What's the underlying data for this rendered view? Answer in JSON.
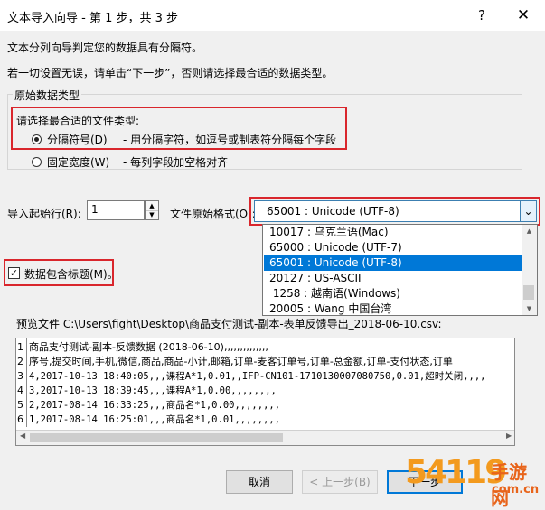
{
  "window": {
    "title": "文本导入向导 - 第 1 步，共 3 步",
    "help_label": "?",
    "close_label": "✕"
  },
  "intro": {
    "line1": "文本分列向导判定您的数据具有分隔符。",
    "line2": "若一切设置无误，请单击“下一步”，否则请选择最合适的数据类型。"
  },
  "data_type": {
    "legend": "原始数据类型",
    "prompt": "请选择最合适的文件类型:",
    "options": [
      {
        "label": "分隔符号(D)",
        "description": "- 用分隔字符，如逗号或制表符分隔每个字段",
        "selected": true
      },
      {
        "label": "固定宽度(W)",
        "description": "- 每列字段加空格对齐",
        "selected": false
      }
    ]
  },
  "import_start": {
    "label": "导入起始行(R):",
    "value": "1"
  },
  "file_origin": {
    "label": "文件原始格式(O):",
    "selected": "65001 : Unicode (UTF-8)",
    "options": [
      "10017 : 乌克兰语(Mac)",
      "65000 : Unicode (UTF-7)",
      "65001 : Unicode (UTF-8)",
      "20127 : US-ASCII",
      " 1258 : 越南语(Windows)",
      "20005 : Wang 中国台湾"
    ],
    "highlighted_index": 2
  },
  "header_checkbox": {
    "label": "数据包含标题(M)。",
    "checked": true,
    "mark": "✓"
  },
  "preview": {
    "label": "预览文件 C:\\Users\\fight\\Desktop\\商品支付测试-副本-表单反馈导出_2018-06-10.csv:",
    "rows": [
      {
        "num": "1",
        "text": "商品支付测试-副本-反馈数据 (2018-06-10),,,,,,,,,,,,,,",
        "mono": false
      },
      {
        "num": "2",
        "text": "序号,提交时间,手机,微信,商品,商品-小计,邮箱,订单-麦客订单号,订单-总金额,订单-支付状态,订单",
        "mono": false
      },
      {
        "num": "3",
        "text": "4,2017-10-13 18:40:05,,,课程A*1,0.01,,IFP-CN101-1710130007080750,0.01,超时关闭,,,,",
        "mono": true
      },
      {
        "num": "4",
        "text": "3,2017-10-13 18:39:45,,,课程A*1,0.00,,,,,,,,",
        "mono": true
      },
      {
        "num": "5",
        "text": "2,2017-08-14 16:33:25,,,商品名*1,0.00,,,,,,,,",
        "mono": true
      },
      {
        "num": "6",
        "text": "1,2017-08-14 16:25:01,,,商品名*1,0.01,,,,,,,,",
        "mono": true
      }
    ]
  },
  "buttons": {
    "cancel": "取消",
    "back": "< 上一步(B)",
    "next": "下一步"
  },
  "watermark": {
    "big": "54119",
    "small1": "手游网",
    "small2": "com.cn"
  },
  "colors": {
    "highlight_box": "#d9262c",
    "selection": "#0078d7",
    "watermark": "#f39a1e"
  }
}
